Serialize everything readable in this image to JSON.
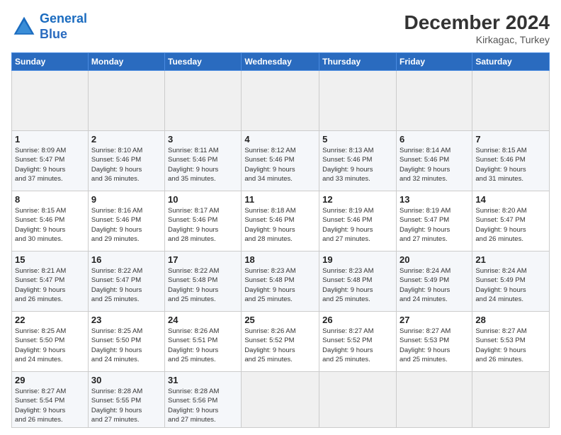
{
  "header": {
    "logo_line1": "General",
    "logo_line2": "Blue",
    "title": "December 2024",
    "subtitle": "Kirkagac, Turkey"
  },
  "calendar": {
    "columns": [
      "Sunday",
      "Monday",
      "Tuesday",
      "Wednesday",
      "Thursday",
      "Friday",
      "Saturday"
    ],
    "weeks": [
      [
        {
          "day": "",
          "info": ""
        },
        {
          "day": "",
          "info": ""
        },
        {
          "day": "",
          "info": ""
        },
        {
          "day": "",
          "info": ""
        },
        {
          "day": "",
          "info": ""
        },
        {
          "day": "",
          "info": ""
        },
        {
          "day": "",
          "info": ""
        }
      ],
      [
        {
          "day": "1",
          "info": "Sunrise: 8:09 AM\nSunset: 5:47 PM\nDaylight: 9 hours\nand 37 minutes."
        },
        {
          "day": "2",
          "info": "Sunrise: 8:10 AM\nSunset: 5:46 PM\nDaylight: 9 hours\nand 36 minutes."
        },
        {
          "day": "3",
          "info": "Sunrise: 8:11 AM\nSunset: 5:46 PM\nDaylight: 9 hours\nand 35 minutes."
        },
        {
          "day": "4",
          "info": "Sunrise: 8:12 AM\nSunset: 5:46 PM\nDaylight: 9 hours\nand 34 minutes."
        },
        {
          "day": "5",
          "info": "Sunrise: 8:13 AM\nSunset: 5:46 PM\nDaylight: 9 hours\nand 33 minutes."
        },
        {
          "day": "6",
          "info": "Sunrise: 8:14 AM\nSunset: 5:46 PM\nDaylight: 9 hours\nand 32 minutes."
        },
        {
          "day": "7",
          "info": "Sunrise: 8:15 AM\nSunset: 5:46 PM\nDaylight: 9 hours\nand 31 minutes."
        }
      ],
      [
        {
          "day": "8",
          "info": "Sunrise: 8:15 AM\nSunset: 5:46 PM\nDaylight: 9 hours\nand 30 minutes."
        },
        {
          "day": "9",
          "info": "Sunrise: 8:16 AM\nSunset: 5:46 PM\nDaylight: 9 hours\nand 29 minutes."
        },
        {
          "day": "10",
          "info": "Sunrise: 8:17 AM\nSunset: 5:46 PM\nDaylight: 9 hours\nand 28 minutes."
        },
        {
          "day": "11",
          "info": "Sunrise: 8:18 AM\nSunset: 5:46 PM\nDaylight: 9 hours\nand 28 minutes."
        },
        {
          "day": "12",
          "info": "Sunrise: 8:19 AM\nSunset: 5:46 PM\nDaylight: 9 hours\nand 27 minutes."
        },
        {
          "day": "13",
          "info": "Sunrise: 8:19 AM\nSunset: 5:47 PM\nDaylight: 9 hours\nand 27 minutes."
        },
        {
          "day": "14",
          "info": "Sunrise: 8:20 AM\nSunset: 5:47 PM\nDaylight: 9 hours\nand 26 minutes."
        }
      ],
      [
        {
          "day": "15",
          "info": "Sunrise: 8:21 AM\nSunset: 5:47 PM\nDaylight: 9 hours\nand 26 minutes."
        },
        {
          "day": "16",
          "info": "Sunrise: 8:22 AM\nSunset: 5:47 PM\nDaylight: 9 hours\nand 25 minutes."
        },
        {
          "day": "17",
          "info": "Sunrise: 8:22 AM\nSunset: 5:48 PM\nDaylight: 9 hours\nand 25 minutes."
        },
        {
          "day": "18",
          "info": "Sunrise: 8:23 AM\nSunset: 5:48 PM\nDaylight: 9 hours\nand 25 minutes."
        },
        {
          "day": "19",
          "info": "Sunrise: 8:23 AM\nSunset: 5:48 PM\nDaylight: 9 hours\nand 25 minutes."
        },
        {
          "day": "20",
          "info": "Sunrise: 8:24 AM\nSunset: 5:49 PM\nDaylight: 9 hours\nand 24 minutes."
        },
        {
          "day": "21",
          "info": "Sunrise: 8:24 AM\nSunset: 5:49 PM\nDaylight: 9 hours\nand 24 minutes."
        }
      ],
      [
        {
          "day": "22",
          "info": "Sunrise: 8:25 AM\nSunset: 5:50 PM\nDaylight: 9 hours\nand 24 minutes."
        },
        {
          "day": "23",
          "info": "Sunrise: 8:25 AM\nSunset: 5:50 PM\nDaylight: 9 hours\nand 24 minutes."
        },
        {
          "day": "24",
          "info": "Sunrise: 8:26 AM\nSunset: 5:51 PM\nDaylight: 9 hours\nand 25 minutes."
        },
        {
          "day": "25",
          "info": "Sunrise: 8:26 AM\nSunset: 5:52 PM\nDaylight: 9 hours\nand 25 minutes."
        },
        {
          "day": "26",
          "info": "Sunrise: 8:27 AM\nSunset: 5:52 PM\nDaylight: 9 hours\nand 25 minutes."
        },
        {
          "day": "27",
          "info": "Sunrise: 8:27 AM\nSunset: 5:53 PM\nDaylight: 9 hours\nand 25 minutes."
        },
        {
          "day": "28",
          "info": "Sunrise: 8:27 AM\nSunset: 5:53 PM\nDaylight: 9 hours\nand 26 minutes."
        }
      ],
      [
        {
          "day": "29",
          "info": "Sunrise: 8:27 AM\nSunset: 5:54 PM\nDaylight: 9 hours\nand 26 minutes."
        },
        {
          "day": "30",
          "info": "Sunrise: 8:28 AM\nSunset: 5:55 PM\nDaylight: 9 hours\nand 27 minutes."
        },
        {
          "day": "31",
          "info": "Sunrise: 8:28 AM\nSunset: 5:56 PM\nDaylight: 9 hours\nand 27 minutes."
        },
        {
          "day": "",
          "info": ""
        },
        {
          "day": "",
          "info": ""
        },
        {
          "day": "",
          "info": ""
        },
        {
          "day": "",
          "info": ""
        }
      ]
    ]
  }
}
